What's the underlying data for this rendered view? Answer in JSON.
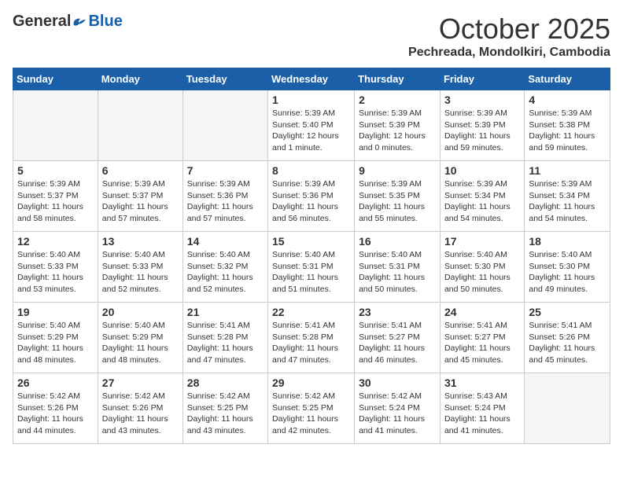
{
  "logo": {
    "general": "General",
    "blue": "Blue"
  },
  "header": {
    "month_title": "October 2025",
    "location": "Pechreada, Mondolkiri, Cambodia"
  },
  "weekdays": [
    "Sunday",
    "Monday",
    "Tuesday",
    "Wednesday",
    "Thursday",
    "Friday",
    "Saturday"
  ],
  "weeks": [
    [
      {
        "day": "",
        "info": ""
      },
      {
        "day": "",
        "info": ""
      },
      {
        "day": "",
        "info": ""
      },
      {
        "day": "1",
        "info": "Sunrise: 5:39 AM\nSunset: 5:40 PM\nDaylight: 12 hours\nand 1 minute."
      },
      {
        "day": "2",
        "info": "Sunrise: 5:39 AM\nSunset: 5:39 PM\nDaylight: 12 hours\nand 0 minutes."
      },
      {
        "day": "3",
        "info": "Sunrise: 5:39 AM\nSunset: 5:39 PM\nDaylight: 11 hours\nand 59 minutes."
      },
      {
        "day": "4",
        "info": "Sunrise: 5:39 AM\nSunset: 5:38 PM\nDaylight: 11 hours\nand 59 minutes."
      }
    ],
    [
      {
        "day": "5",
        "info": "Sunrise: 5:39 AM\nSunset: 5:37 PM\nDaylight: 11 hours\nand 58 minutes."
      },
      {
        "day": "6",
        "info": "Sunrise: 5:39 AM\nSunset: 5:37 PM\nDaylight: 11 hours\nand 57 minutes."
      },
      {
        "day": "7",
        "info": "Sunrise: 5:39 AM\nSunset: 5:36 PM\nDaylight: 11 hours\nand 57 minutes."
      },
      {
        "day": "8",
        "info": "Sunrise: 5:39 AM\nSunset: 5:36 PM\nDaylight: 11 hours\nand 56 minutes."
      },
      {
        "day": "9",
        "info": "Sunrise: 5:39 AM\nSunset: 5:35 PM\nDaylight: 11 hours\nand 55 minutes."
      },
      {
        "day": "10",
        "info": "Sunrise: 5:39 AM\nSunset: 5:34 PM\nDaylight: 11 hours\nand 54 minutes."
      },
      {
        "day": "11",
        "info": "Sunrise: 5:39 AM\nSunset: 5:34 PM\nDaylight: 11 hours\nand 54 minutes."
      }
    ],
    [
      {
        "day": "12",
        "info": "Sunrise: 5:40 AM\nSunset: 5:33 PM\nDaylight: 11 hours\nand 53 minutes."
      },
      {
        "day": "13",
        "info": "Sunrise: 5:40 AM\nSunset: 5:33 PM\nDaylight: 11 hours\nand 52 minutes."
      },
      {
        "day": "14",
        "info": "Sunrise: 5:40 AM\nSunset: 5:32 PM\nDaylight: 11 hours\nand 52 minutes."
      },
      {
        "day": "15",
        "info": "Sunrise: 5:40 AM\nSunset: 5:31 PM\nDaylight: 11 hours\nand 51 minutes."
      },
      {
        "day": "16",
        "info": "Sunrise: 5:40 AM\nSunset: 5:31 PM\nDaylight: 11 hours\nand 50 minutes."
      },
      {
        "day": "17",
        "info": "Sunrise: 5:40 AM\nSunset: 5:30 PM\nDaylight: 11 hours\nand 50 minutes."
      },
      {
        "day": "18",
        "info": "Sunrise: 5:40 AM\nSunset: 5:30 PM\nDaylight: 11 hours\nand 49 minutes."
      }
    ],
    [
      {
        "day": "19",
        "info": "Sunrise: 5:40 AM\nSunset: 5:29 PM\nDaylight: 11 hours\nand 48 minutes."
      },
      {
        "day": "20",
        "info": "Sunrise: 5:40 AM\nSunset: 5:29 PM\nDaylight: 11 hours\nand 48 minutes."
      },
      {
        "day": "21",
        "info": "Sunrise: 5:41 AM\nSunset: 5:28 PM\nDaylight: 11 hours\nand 47 minutes."
      },
      {
        "day": "22",
        "info": "Sunrise: 5:41 AM\nSunset: 5:28 PM\nDaylight: 11 hours\nand 47 minutes."
      },
      {
        "day": "23",
        "info": "Sunrise: 5:41 AM\nSunset: 5:27 PM\nDaylight: 11 hours\nand 46 minutes."
      },
      {
        "day": "24",
        "info": "Sunrise: 5:41 AM\nSunset: 5:27 PM\nDaylight: 11 hours\nand 45 minutes."
      },
      {
        "day": "25",
        "info": "Sunrise: 5:41 AM\nSunset: 5:26 PM\nDaylight: 11 hours\nand 45 minutes."
      }
    ],
    [
      {
        "day": "26",
        "info": "Sunrise: 5:42 AM\nSunset: 5:26 PM\nDaylight: 11 hours\nand 44 minutes."
      },
      {
        "day": "27",
        "info": "Sunrise: 5:42 AM\nSunset: 5:26 PM\nDaylight: 11 hours\nand 43 minutes."
      },
      {
        "day": "28",
        "info": "Sunrise: 5:42 AM\nSunset: 5:25 PM\nDaylight: 11 hours\nand 43 minutes."
      },
      {
        "day": "29",
        "info": "Sunrise: 5:42 AM\nSunset: 5:25 PM\nDaylight: 11 hours\nand 42 minutes."
      },
      {
        "day": "30",
        "info": "Sunrise: 5:42 AM\nSunset: 5:24 PM\nDaylight: 11 hours\nand 41 minutes."
      },
      {
        "day": "31",
        "info": "Sunrise: 5:43 AM\nSunset: 5:24 PM\nDaylight: 11 hours\nand 41 minutes."
      },
      {
        "day": "",
        "info": ""
      }
    ]
  ]
}
